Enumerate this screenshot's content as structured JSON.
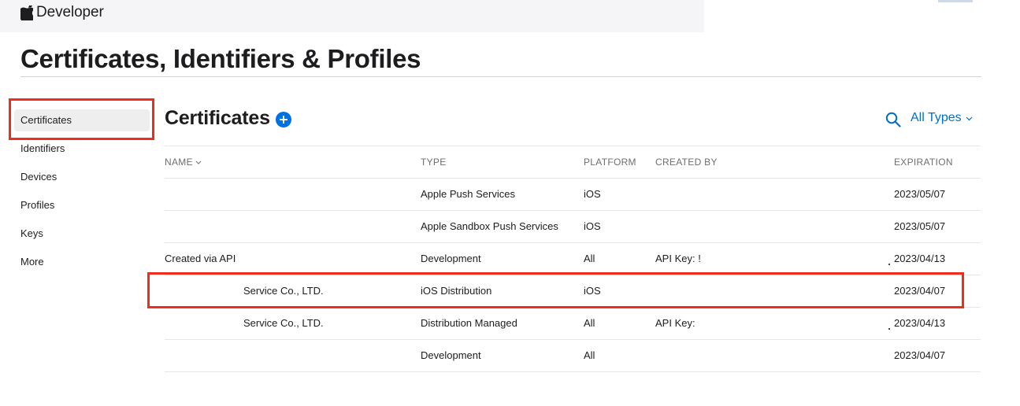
{
  "header": {
    "brand": "Developer"
  },
  "page": {
    "title": "Certificates, Identifiers & Profiles"
  },
  "sidebar": {
    "items": [
      {
        "label": "Certificates",
        "active": true
      },
      {
        "label": "Identifiers"
      },
      {
        "label": "Devices"
      },
      {
        "label": "Profiles"
      },
      {
        "label": "Keys"
      },
      {
        "label": "More"
      }
    ]
  },
  "main": {
    "title": "Certificates",
    "filter_label": "All Types",
    "columns": [
      "NAME",
      "TYPE",
      "PLATFORM",
      "CREATED BY",
      "EXPIRATION"
    ],
    "rows": [
      {
        "name": "",
        "type": "Apple Push Services",
        "platform": "iOS",
        "created_by": "",
        "expiration": "2023/05/07"
      },
      {
        "name": "",
        "type": "Apple Sandbox Push Services",
        "platform": "iOS",
        "created_by": "",
        "expiration": "2023/05/07"
      },
      {
        "name": "Created via API",
        "type": "Development",
        "platform": "All",
        "created_by": "API Key: !",
        "expiration": "2023/04/13"
      },
      {
        "name": "Service Co., LTD.",
        "type": "iOS Distribution",
        "platform": "iOS",
        "created_by": "",
        "expiration": "2023/04/07"
      },
      {
        "name": "Service Co., LTD.",
        "type": "Distribution Managed",
        "platform": "All",
        "created_by": "API Key:",
        "expiration": "2023/04/13"
      },
      {
        "name": "",
        "type": "Development",
        "platform": "All",
        "created_by": "",
        "expiration": "2023/04/07"
      }
    ]
  },
  "colors": {
    "accent": "#0071e3",
    "highlight": "#ee2d1a",
    "link": "#0070c9"
  }
}
